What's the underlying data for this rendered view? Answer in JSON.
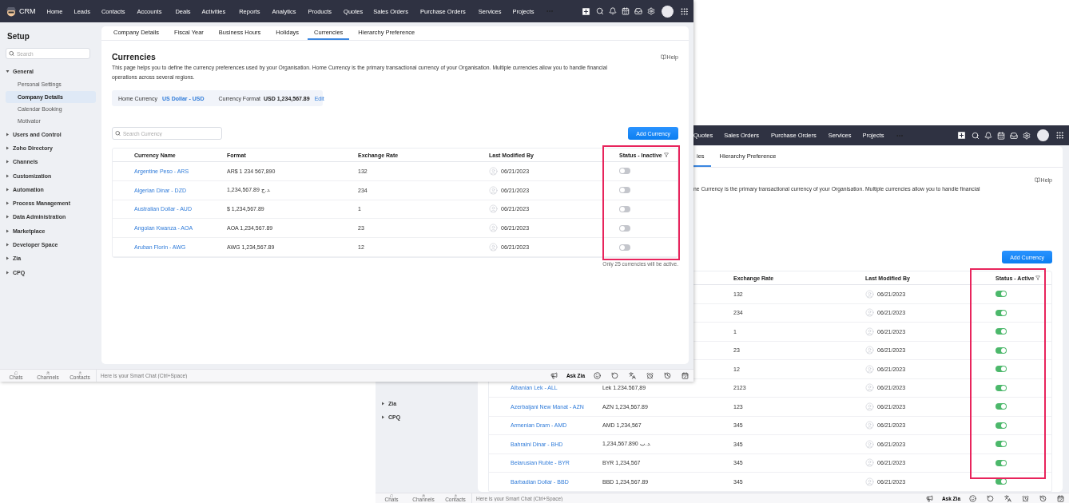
{
  "front_window": {
    "nav": {
      "brand": "CRM",
      "items": [
        "Home",
        "Leads",
        "Contacts",
        "Accounts",
        "Deals",
        "Activities",
        "Reports",
        "Analytics",
        "Products",
        "Quotes",
        "Sales Orders",
        "Purchase Orders",
        "Services",
        "Projects"
      ]
    },
    "sidebar": {
      "title": "Setup",
      "search_placeholder": "Search",
      "sections": [
        {
          "label": "General",
          "expanded": true,
          "children": [
            {
              "label": "Personal Settings",
              "selected": false
            },
            {
              "label": "Company Details",
              "selected": true
            },
            {
              "label": "Calendar Booking",
              "selected": false
            },
            {
              "label": "Motivator",
              "selected": false
            }
          ]
        },
        {
          "label": "Users and Control",
          "expanded": false
        },
        {
          "label": "Zoho Directory",
          "expanded": false
        },
        {
          "label": "Channels",
          "expanded": false
        },
        {
          "label": "Customization",
          "expanded": false
        },
        {
          "label": "Automation",
          "expanded": false
        },
        {
          "label": "Process Management",
          "expanded": false
        },
        {
          "label": "Data Administration",
          "expanded": false
        },
        {
          "label": "Marketplace",
          "expanded": false
        },
        {
          "label": "Developer Space",
          "expanded": false
        },
        {
          "label": "Zia",
          "expanded": false
        },
        {
          "label": "CPQ",
          "expanded": false
        }
      ]
    },
    "tabs": [
      {
        "label": "Company Details",
        "selected": false
      },
      {
        "label": "Fiscal Year",
        "selected": false
      },
      {
        "label": "Business Hours",
        "selected": false
      },
      {
        "label": "Holidays",
        "selected": false
      },
      {
        "label": "Currencies",
        "selected": true
      },
      {
        "label": "Hierarchy Preference",
        "selected": false
      }
    ],
    "page": {
      "title": "Currencies",
      "help": "Help",
      "description": "This page helps you to define the currency preferences used by your Organisation. Home Currency is the primary transactional currency of your Organisation. Multiple currencies allow you to handle financial operations across several regions.",
      "home_currency_label": "Home Currency",
      "home_currency": "US Dollar - USD",
      "format_label": "Currency Format",
      "format_value": "USD 1,234,567.89",
      "edit": "Edit"
    },
    "search": {
      "placeholder": "Search Currency"
    },
    "add_button": "Add Currency",
    "table": {
      "highlighted": true,
      "columns": [
        "Currency Name",
        "Format",
        "Exchange Rate",
        "Last Modified By",
        "Status - Inactive"
      ],
      "rows": [
        {
          "name": "Argentine Peso - ARS",
          "format": "AR$ 1 234 567,890",
          "rate": "132",
          "modified": "06/21/2023",
          "active": false
        },
        {
          "name": "Algerian Dinar - DZD",
          "format": "1,234,567.89 د.ج.",
          "rate": "234",
          "modified": "06/21/2023",
          "active": false
        },
        {
          "name": "Australian Dollar - AUD",
          "format": "$ 1,234,567.89",
          "rate": "1",
          "modified": "06/21/2023",
          "active": false
        },
        {
          "name": "Angolan Kwanza - AOA",
          "format": "AOA 1,234,567.89",
          "rate": "23",
          "modified": "06/21/2023",
          "active": false
        },
        {
          "name": "Aruban Florin - AWG",
          "format": "AWG 1,234,567.89",
          "rate": "12",
          "modified": "06/21/2023",
          "active": false
        }
      ]
    },
    "note": "Only 25 currencies will be active.",
    "bottom_bar": {
      "shortcuts": [
        "Chats",
        "Channels",
        "Contacts"
      ],
      "chat_placeholder": "Here is your Smart Chat (Ctrl+Space)",
      "ask_zia": "Ask Zia"
    }
  },
  "back_window": {
    "nav": {
      "items": [
        "Quotes",
        "Sales Orders",
        "Purchase Orders",
        "Services",
        "Projects"
      ]
    },
    "sidebar": {
      "sections": [
        {
          "label": "Zia",
          "expanded": false
        },
        {
          "label": "CPQ",
          "expanded": false
        }
      ]
    },
    "tabs": [
      {
        "label": "ies",
        "selected": true
      },
      {
        "label": "Hierarchy Preference",
        "selected": false
      }
    ],
    "page": {
      "help": "Help",
      "description": "ne Currency is the primary transactional currency of your Organisation. Multiple currencies allow you to handle financial"
    },
    "add_button": "Add Currency",
    "table": {
      "highlighted": true,
      "columns": [
        "Exchange Rate",
        "Last Modified By",
        "Status - Active"
      ],
      "rows": [
        {
          "rate": "132",
          "modified": "06/21/2023",
          "active": true
        },
        {
          "rate": "234",
          "modified": "06/21/2023",
          "active": true
        },
        {
          "rate": "1",
          "modified": "06/21/2023",
          "active": true
        },
        {
          "rate": "23",
          "modified": "06/21/2023",
          "active": true
        },
        {
          "rate": "12",
          "modified": "06/21/2023",
          "active": true
        },
        {
          "name": "Albanian Lek - ALL",
          "format": "Lek 1.234.567,89",
          "rate": "2123",
          "modified": "06/21/2023",
          "active": true
        },
        {
          "name": "Azerbaijani New Manat - AZN",
          "format": "AZN 1,234,567.89",
          "rate": "123",
          "modified": "06/21/2023",
          "active": true
        },
        {
          "name": "Armenian Dram - AMD",
          "format": "AMD 1,234,567",
          "rate": "345",
          "modified": "06/21/2023",
          "active": true
        },
        {
          "name": "Bahraini Dinar - BHD",
          "format": "1,234,567.890 د.ب.",
          "rate": "345",
          "modified": "06/21/2023",
          "active": true
        },
        {
          "name": "Belarusian Ruble - BYR",
          "format": "BYR 1,234,567",
          "rate": "345",
          "modified": "06/21/2023",
          "active": true
        },
        {
          "name": "Barbadian Dollar - BBD",
          "format": "BBD 1,234,567.89",
          "rate": "345",
          "modified": "06/21/2023",
          "active": true
        }
      ]
    },
    "bottom_bar": {
      "shortcuts": [
        "Chats",
        "Channels",
        "Contacts"
      ],
      "chat_placeholder": "Here is your Smart Chat (Ctrl+Space)",
      "ask_zia": "Ask Zia"
    }
  }
}
